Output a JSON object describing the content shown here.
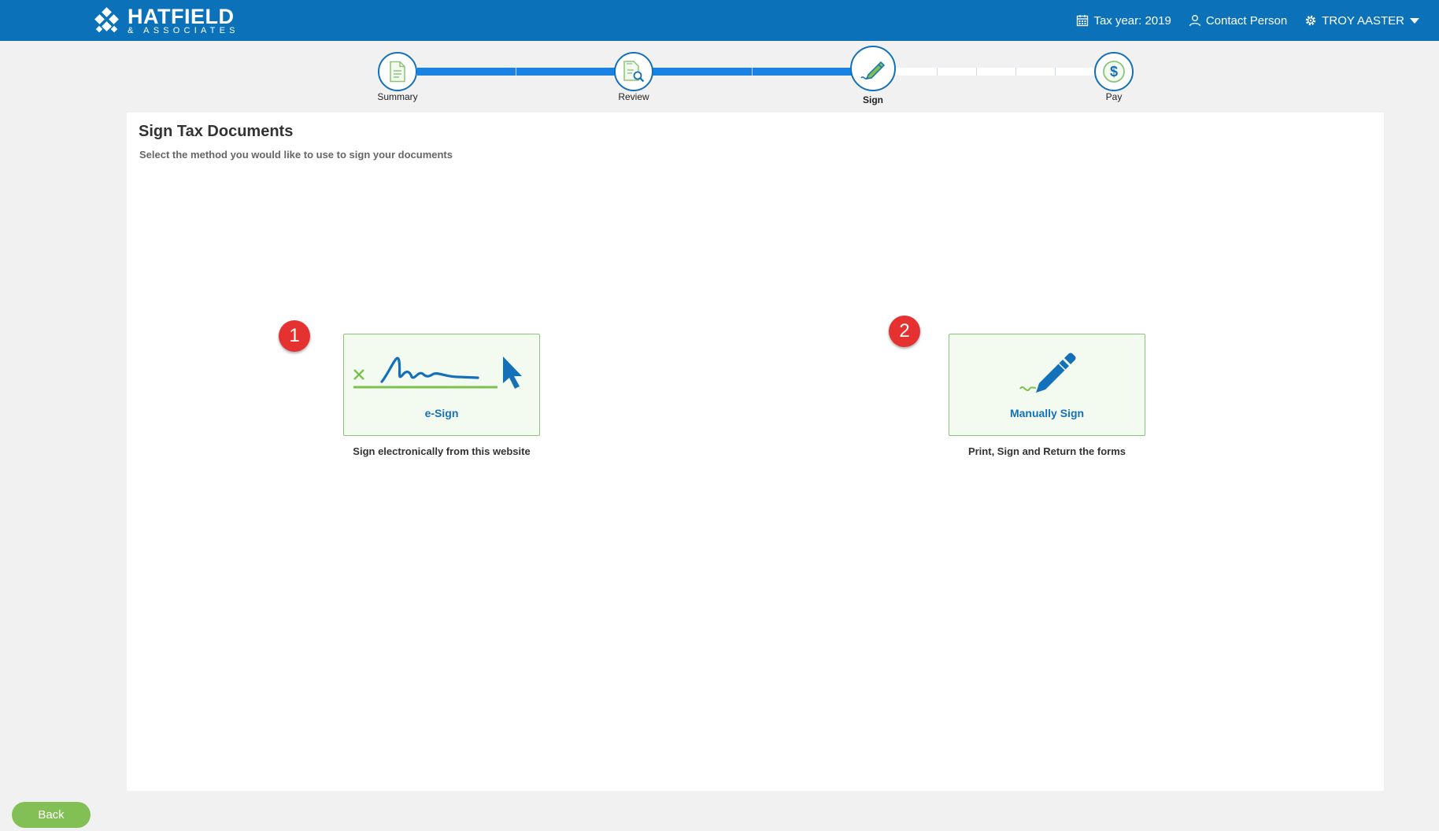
{
  "brand": {
    "name": "HATFIELD",
    "sub": "& ASSOCIATES"
  },
  "header": {
    "tax_year": "Tax year: 2019",
    "contact": "Contact Person",
    "user": "TROY AASTER"
  },
  "steps": [
    {
      "label": "Summary"
    },
    {
      "label": "Review"
    },
    {
      "label": "Sign"
    },
    {
      "label": "Pay"
    }
  ],
  "main": {
    "title": "Sign Tax Documents",
    "subtitle": "Select the method you would like to use to sign your documents",
    "options": [
      {
        "badge": "1",
        "title": "e-Sign",
        "desc": "Sign electronically from this website"
      },
      {
        "badge": "2",
        "title": "Manually Sign",
        "desc": "Print, Sign and Return the forms"
      }
    ]
  },
  "footer": {
    "back_label": "Back"
  },
  "colors": {
    "header": "#0b72ba",
    "accent": "#1a82e2",
    "green": "#82c055",
    "badge": "#e5312f"
  }
}
